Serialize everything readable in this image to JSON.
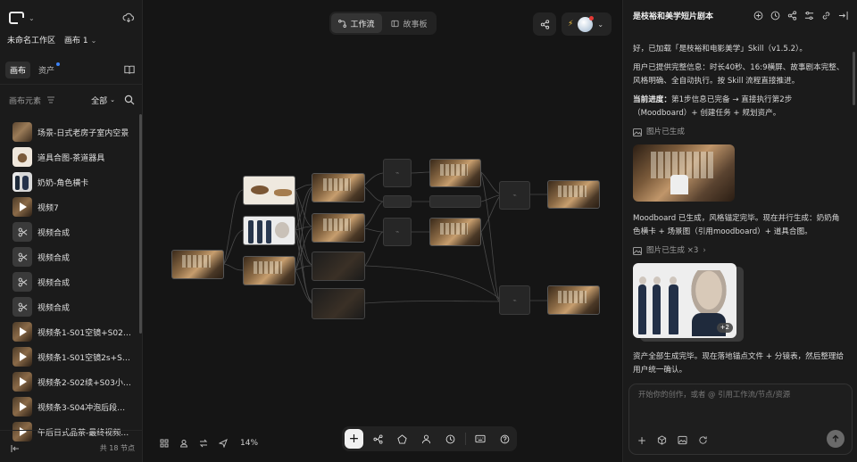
{
  "sidebar": {
    "workspace": "未命名工作区",
    "canvas_name": "画布 1",
    "tabs": [
      {
        "label": "画布"
      },
      {
        "label": "资产"
      }
    ],
    "section_title": "画布元素",
    "filter_label": "全部",
    "items": [
      {
        "label": "场景-日式老房子室内空景",
        "kind": "room"
      },
      {
        "label": "道具合图-茶道器具",
        "kind": "tea"
      },
      {
        "label": "奶奶-角色横卡",
        "kind": "granny"
      },
      {
        "label": "视频7",
        "kind": "video"
      },
      {
        "label": "视频合成",
        "kind": "cut"
      },
      {
        "label": "视频合成",
        "kind": "cut"
      },
      {
        "label": "视频合成",
        "kind": "cut"
      },
      {
        "label": "视频合成",
        "kind": "cut"
      },
      {
        "label": "视频条1-S01空镜+S02擦...",
        "kind": "video"
      },
      {
        "label": "视频条1-S01空镜2s+S02...",
        "kind": "video"
      },
      {
        "label": "视频条2-S02续+S03小猫...",
        "kind": "video"
      },
      {
        "label": "视频条3-S04冲泡后段+S...",
        "kind": "video"
      },
      {
        "label": "午后日式品茶-最终视频剪...",
        "kind": "video"
      }
    ],
    "node_count": "共 18 节点"
  },
  "canvas": {
    "view_tabs": [
      {
        "label": "工作流"
      },
      {
        "label": "故事板"
      }
    ],
    "zoom": "14%"
  },
  "chat": {
    "title": "是枝裕和美学短片剧本",
    "messages": [
      "好，已加载「是枝裕和电影美学」Skill（v1.5.2）。",
      "用户已提供完整信息：时长40秒、16:9横屏、故事剧本完整、风格明确、全自动执行。按 Skill 流程直接推进。",
      "第1步信息已完备 → 直接执行第2步（Moodboard）+ 创建任务 + 规划资产。"
    ],
    "progress_label": "当前进度：",
    "gen_label_1": "图片已生成",
    "after_img_1": "Moodboard 已生成，风格锚定完毕。现在并行生成：奶奶角色横卡 + 场景图（引用moodboard）+ 道具合图。",
    "gen_label_2": "图片已生成 ×3",
    "image_badge": "+2",
    "after_img_2": "资产全部生成完毕。现在落地锚点文件 + 分镜表，然后整理给用户统一确认。",
    "input_placeholder": "开始你的创作，或者 @ 引用工作流/节点/资源"
  },
  "colors": {
    "background": "#141414",
    "panel": "#1b1b1b",
    "accent_dot": "#3b82f6",
    "notify_dot": "#e53935"
  }
}
